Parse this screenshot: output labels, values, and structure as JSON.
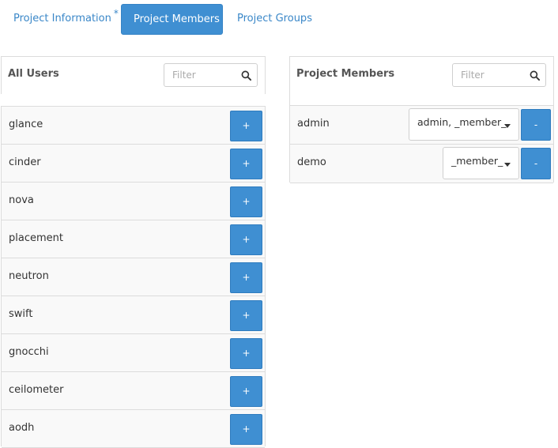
{
  "tabs": [
    {
      "label": "Project Information",
      "required_marker": "*"
    },
    {
      "label": "Project Members"
    },
    {
      "label": "Project Groups"
    }
  ],
  "all_users": {
    "title": "All Users",
    "filter_placeholder": "Filter",
    "add_label": "+",
    "items": [
      {
        "name": "glance"
      },
      {
        "name": "cinder"
      },
      {
        "name": "nova"
      },
      {
        "name": "placement"
      },
      {
        "name": "neutron"
      },
      {
        "name": "swift"
      },
      {
        "name": "gnocchi"
      },
      {
        "name": "ceilometer"
      },
      {
        "name": "aodh"
      }
    ]
  },
  "project_members": {
    "title": "Project Members",
    "filter_placeholder": "Filter",
    "remove_label": "-",
    "items": [
      {
        "name": "admin",
        "roles": "admin, _member_"
      },
      {
        "name": "demo",
        "roles": "_member_"
      }
    ]
  },
  "colors": {
    "accent": "#3f8fd2",
    "link": "#3a87c8"
  },
  "icons": {
    "filter": "search-icon",
    "dropdown": "caret-down-icon"
  }
}
